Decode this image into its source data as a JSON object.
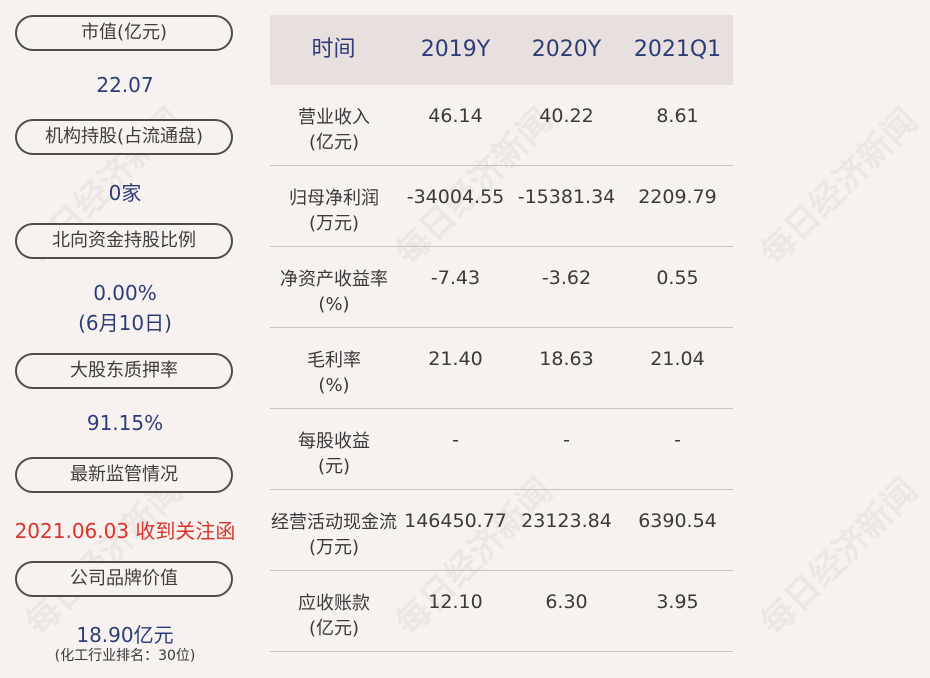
{
  "left_panel": {
    "items": [
      {
        "label": "市值(亿元)",
        "value": "22.07"
      },
      {
        "label": "机构持股(占流通盘)",
        "value": "0家"
      },
      {
        "label": "北向资金持股比例",
        "value": "0.00%",
        "value2": "(6月10日)"
      },
      {
        "label": "大股东质押率",
        "value": "91.15%"
      },
      {
        "label": "最新监管情况",
        "value": "2021.06.03 收到关注函"
      },
      {
        "label": "公司品牌价值",
        "value": "18.90亿元",
        "note": "(化工行业排名：30位)"
      }
    ]
  },
  "table": {
    "headers": [
      "时间",
      "2019Y",
      "2020Y",
      "2021Q1"
    ],
    "rows": [
      {
        "label": "营业收入",
        "unit": "(亿元)",
        "values": [
          "46.14",
          "40.22",
          "8.61"
        ]
      },
      {
        "label": "归母净利润",
        "unit": "(万元)",
        "values": [
          "-34004.55",
          "-15381.34",
          "2209.79"
        ]
      },
      {
        "label": "净资产收益率",
        "unit": "(%)",
        "values": [
          "-7.43",
          "-3.62",
          "0.55"
        ]
      },
      {
        "label": "毛利率",
        "unit": "(%)",
        "values": [
          "21.40",
          "18.63",
          "21.04"
        ]
      },
      {
        "label": "每股收益",
        "unit": "(元)",
        "values": [
          "-",
          "-",
          "-"
        ]
      },
      {
        "label": "经营活动现金流",
        "unit": "(万元)",
        "values": [
          "146450.77",
          "23123.84",
          "6390.54"
        ]
      },
      {
        "label": "应收账款",
        "unit": "(亿元)",
        "values": [
          "12.10",
          "6.30",
          "3.95"
        ]
      }
    ]
  },
  "watermark": "每日经济新闻",
  "colors": {
    "background": "#f7f1ef",
    "value_blue": "#2d3d78",
    "alert_red": "#d8342c",
    "header_bg": "#e8e0de"
  }
}
